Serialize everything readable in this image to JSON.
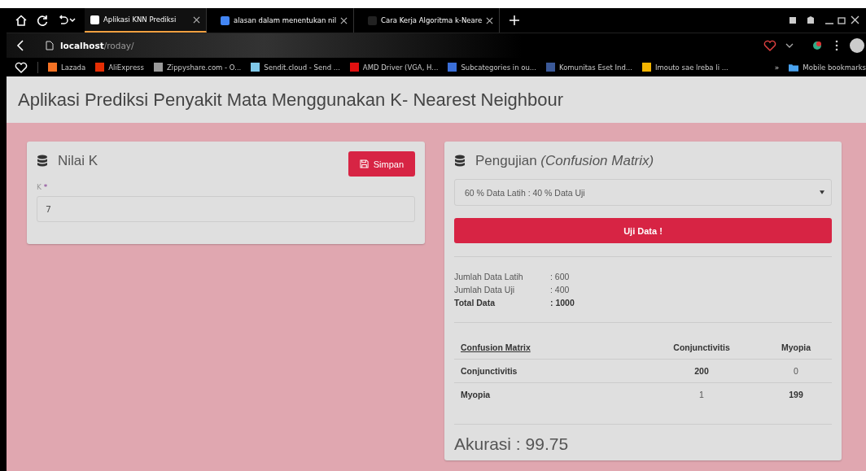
{
  "browser": {
    "tabs": [
      {
        "title": "Aplikasi KNN Prediksi",
        "selected": true,
        "color": "#ffffff"
      },
      {
        "title": "alasan dalam menentukan nil",
        "selected": false,
        "color": "#4285f4"
      },
      {
        "title": "Cara Kerja Algoritma k-Neare",
        "selected": false,
        "color": "#222222"
      }
    ],
    "address": {
      "host": "localhost",
      "path": "/roday/"
    },
    "bookmarks": [
      {
        "title": "Lazada",
        "color": "#f57224"
      },
      {
        "title": "AliExpress",
        "color": "#e62e04"
      },
      {
        "title": "Zippyshare.com - O...",
        "color": "#9a9a9a"
      },
      {
        "title": "Sendit.cloud - Send ...",
        "color": "#7fc8e8"
      },
      {
        "title": "AMD Driver (VGA, H...",
        "color": "#e01010"
      },
      {
        "title": "Subcategories in ou...",
        "color": "#3b6fd8"
      },
      {
        "title": "Komunitas Eset Ind...",
        "color": "#3b5998"
      },
      {
        "title": "Imouto sae lreba li ...",
        "color": "#f4b400"
      }
    ],
    "more": "»",
    "mobile_bookmarks": "Mobile bookmarks"
  },
  "page": {
    "title": "Aplikasi Prediksi Penyakit Mata Menggunakan K- Nearest Neighbour",
    "k_panel": {
      "title": "Nilai K",
      "save_button": "Simpan",
      "field_label": "K",
      "required_mark": "*",
      "value": "7"
    },
    "test_panel": {
      "title": "Pengujian",
      "title_note": "(Confusion Matrix)",
      "split_select": "60 % Data Latih : 40 % Data Uji",
      "test_button": "Uji Data !",
      "stats": [
        {
          "label": "Jumlah Data Latih",
          "value": ": 600",
          "bold": false
        },
        {
          "label": "Jumlah Data Uji",
          "value": ": 400",
          "bold": false
        },
        {
          "label": "Total Data",
          "value": ": 1000",
          "bold": true
        }
      ],
      "matrix": {
        "columns": [
          "Confusion Matrix",
          "Conjunctivitis",
          "Myopia"
        ],
        "rows": [
          {
            "cells": [
              {
                "value": "Conjunctivitis",
                "bold": true
              },
              {
                "value": "200",
                "bold": true
              },
              {
                "value": "0",
                "bold": false
              }
            ]
          },
          {
            "cells": [
              {
                "value": "Myopia",
                "bold": true
              },
              {
                "value": "1",
                "bold": false
              },
              {
                "value": "199",
                "bold": true
              }
            ]
          }
        ]
      },
      "accuracy": "Akurasi : 99.75"
    }
  }
}
